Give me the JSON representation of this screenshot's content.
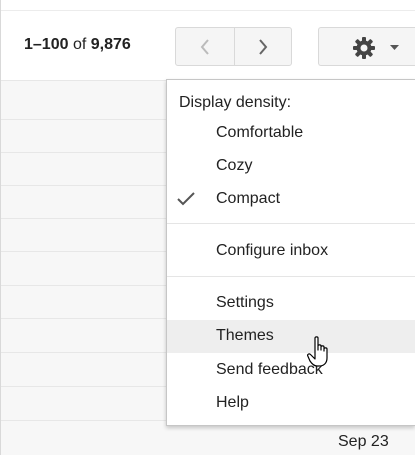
{
  "toolbar": {
    "pager_range": "1–100",
    "pager_of": "of",
    "pager_total": "9,876"
  },
  "icons": {
    "prev": "chevron-left-icon",
    "next": "chevron-right-icon",
    "settings": "gear-icon",
    "dropdown": "caret-down-icon",
    "checked": "check-icon",
    "cursor": "hand-pointer-icon"
  },
  "menu": {
    "density_label": "Display density:",
    "density_options": [
      {
        "label": "Comfortable",
        "selected": false
      },
      {
        "label": "Cozy",
        "selected": false
      },
      {
        "label": "Compact",
        "selected": true
      }
    ],
    "configure_inbox": "Configure inbox",
    "items": [
      {
        "label": "Settings",
        "hovered": false
      },
      {
        "label": "Themes",
        "hovered": true
      },
      {
        "label": "Send feedback",
        "hovered": false
      },
      {
        "label": "Help",
        "hovered": false
      }
    ]
  },
  "list": {
    "visible_date": "Sep 23"
  },
  "colors": {
    "border": "#d9d9d9",
    "hover": "#eeeeee",
    "text": "#222222",
    "icon": "#444444"
  }
}
